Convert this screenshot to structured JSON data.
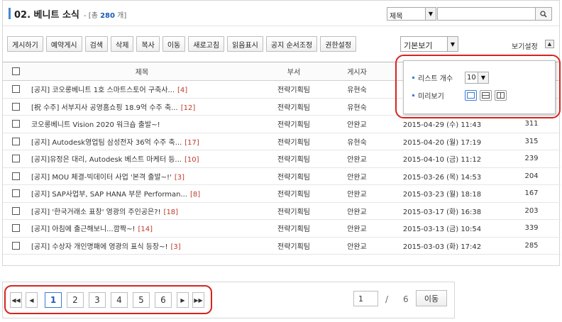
{
  "header": {
    "title": "02. 베니트 소식",
    "count_prefix": "- [총",
    "count_value": "280",
    "count_suffix": "개]",
    "search_field": "제목",
    "search_value": ""
  },
  "toolbar": {
    "buttons": [
      "게시하기",
      "예약게시",
      "검색",
      "삭제",
      "복사",
      "이동",
      "새로고침",
      "읽음표시",
      "공지 순서조정",
      "권한설정"
    ],
    "view_mode": "기본보기",
    "view_settings_label": "보기설정"
  },
  "table": {
    "columns": [
      "제목",
      "부서",
      "게시자",
      "",
      ""
    ],
    "rows": [
      {
        "subject": "[공지] 코오롱베니트 1호 스마트스토어 구축사...",
        "comments": "[4]",
        "dept": "전략기획팀",
        "author": "유현숙",
        "date": "",
        "views": ""
      },
      {
        "subject": "[祝 수주] 서부지사 공영홈쇼핑 18.9억 수주 축...",
        "comments": "[12]",
        "dept": "전략기획팀",
        "author": "유현숙",
        "date": "",
        "views": ""
      },
      {
        "subject": "코오롱베니트 Vision 2020 워크숍 출발~!",
        "comments": "",
        "dept": "전략기획팀",
        "author": "안완교",
        "date": "2015-04-29 (수) 11:43",
        "views": "311"
      },
      {
        "subject": "[공지] Autodesk영업팀 삼성전자 36억 수주 축...",
        "comments": "[17]",
        "dept": "전략기획팀",
        "author": "유현숙",
        "date": "2015-04-20 (월) 17:19",
        "views": "315"
      },
      {
        "subject": "[공지]유정은 대리, Autodesk 베스트 마케터 등...",
        "comments": "[10]",
        "dept": "전략기획팀",
        "author": "안완교",
        "date": "2015-04-10 (금) 11:12",
        "views": "239"
      },
      {
        "subject": "[공지] MOU 체결-빅데이터 사업 '본격 출발~!'",
        "comments": "[3]",
        "dept": "전략기획팀",
        "author": "안완교",
        "date": "2015-03-26 (목) 14:53",
        "views": "204"
      },
      {
        "subject": "[공지] SAP사업부, SAP HANA 부문 Performan...",
        "comments": "[8]",
        "dept": "전략기획팀",
        "author": "안완교",
        "date": "2015-03-23 (월) 18:18",
        "views": "167"
      },
      {
        "subject": "[공지] '한국거래소 표창' 영광의 주인공은?!",
        "comments": "[18]",
        "dept": "전략기획팀",
        "author": "안완교",
        "date": "2015-03-17 (화) 16:38",
        "views": "203"
      },
      {
        "subject": "[공지] 아침에 출근해보니...깜짝~!",
        "comments": "[14]",
        "dept": "전략기획팀",
        "author": "안완교",
        "date": "2015-03-13 (금) 10:54",
        "views": "339"
      },
      {
        "subject": "[공지] 수상자 개인명패에 영광의 표식 등장~!",
        "comments": "[3]",
        "dept": "전략기획팀",
        "author": "안완교",
        "date": "2015-03-03 (화) 17:42",
        "views": "285"
      }
    ]
  },
  "view_settings": {
    "list_count_label": "리스트 개수",
    "list_count_value": "10",
    "preview_label": "미리보기"
  },
  "pager": {
    "pages": [
      "1",
      "2",
      "3",
      "4",
      "5",
      "6"
    ],
    "current": "1",
    "page_input": "1",
    "separator": "/",
    "total_pages": "6",
    "go_label": "이동"
  },
  "colors": {
    "accent": "#4a88d2",
    "comment": "#c0392b",
    "highlight_oval": "#d8231f"
  }
}
